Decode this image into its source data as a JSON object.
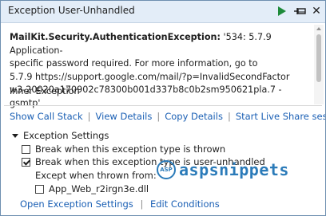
{
  "window": {
    "title": "Exception User-Unhandled",
    "icons": [
      "play-icon",
      "pin-icon",
      "close-icon"
    ],
    "close_glyph": "✕"
  },
  "exception": {
    "type": "MailKit.Security.AuthenticationException:",
    "message_line1": " '534: 5.7.9 Application-",
    "message_line2": "specific password required. For more information, go to",
    "message_line3": "5.7.9  https://support.google.com/mail/?p=InvalidSecondFactor",
    "message_line4": "w3-20020a170902c78300b001d337b8c0b2sm950621pla.7 - gsmtp'",
    "inner_label": "Inner Exception"
  },
  "actions": {
    "show_call_stack": "Show Call Stack",
    "view_details": "View Details",
    "copy_details": "Copy Details",
    "live_share": "Start Live Share session",
    "separator": "|"
  },
  "settings": {
    "heading": "Exception Settings",
    "break_thrown": "Break when this exception type is thrown",
    "break_thrown_checked": false,
    "break_user_unhandled": "Break when this exception type is user-unhandled",
    "break_user_unhandled_checked": true,
    "except_when": "Except when thrown from:",
    "module": "App_Web_r2irgn3e.dll",
    "module_checked": false
  },
  "footer": {
    "open_settings": "Open Exception Settings",
    "edit_conditions": "Edit Conditions",
    "separator": "|"
  },
  "watermark": {
    "text": "aspsnippets",
    "icon_glyph": "ASP"
  },
  "colors": {
    "link": "#1a5fb4",
    "titlebar": "#e3edf8",
    "play": "#1e8a3a",
    "watermark": "#2b7bb9"
  }
}
